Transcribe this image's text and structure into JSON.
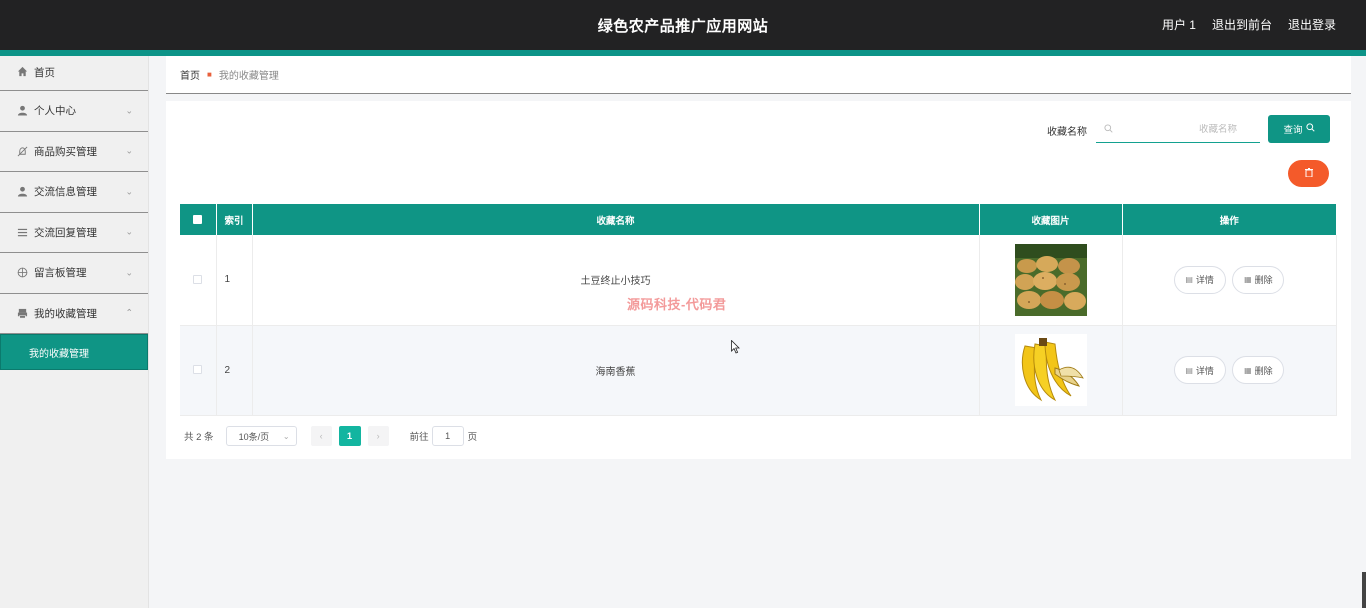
{
  "header": {
    "title": "绿色农产品推广应用网站",
    "user_label": "用户 1",
    "front_label": "退出到前台",
    "logout_label": "退出登录"
  },
  "sidebar": {
    "items": [
      {
        "label": "首页",
        "icon": "home-icon"
      },
      {
        "label": "个人中心",
        "icon": "user-icon"
      },
      {
        "label": "商品购买管理",
        "icon": "bell-off-icon"
      },
      {
        "label": "交流信息管理",
        "icon": "user-icon"
      },
      {
        "label": "交流回复管理",
        "icon": "list-icon"
      },
      {
        "label": "留言板管理",
        "icon": "globe-icon"
      },
      {
        "label": "我的收藏管理",
        "icon": "printer-icon"
      }
    ],
    "active_sub": "我的收藏管理"
  },
  "breadcrumb": {
    "home": "首页",
    "current": "我的收藏管理"
  },
  "search": {
    "label": "收藏名称",
    "placeholder": "收藏名称",
    "value": "",
    "button_label": "查询"
  },
  "table": {
    "columns": [
      "索引",
      "收藏名称",
      "收藏图片",
      "操作"
    ],
    "rows": [
      {
        "index": "1",
        "name": "土豆终止小技巧",
        "image": "potatoes"
      },
      {
        "index": "2",
        "name": "海南香蕉",
        "image": "bananas"
      }
    ],
    "detail_label": "详情",
    "delete_label": "删除"
  },
  "pagination": {
    "total_text": "共 2 条",
    "page_size": "10条/页",
    "current_page": "1",
    "goto_label": "前往",
    "goto_value": "1",
    "goto_suffix": "页"
  },
  "watermark": "源码科技-代码君",
  "colors": {
    "primary": "#0f9585",
    "header_bg": "#222223",
    "danger": "#f45a2a",
    "watermark": "#f39a9a"
  }
}
